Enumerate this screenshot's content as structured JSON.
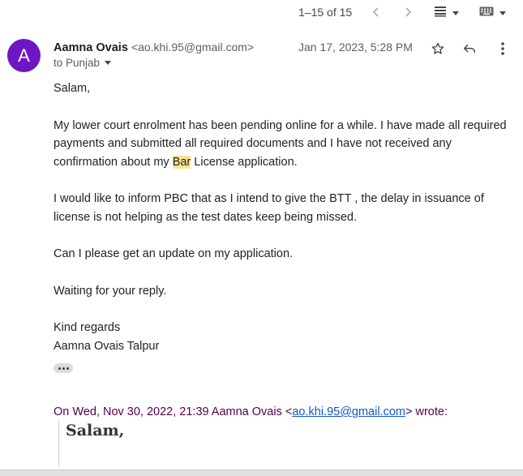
{
  "toolbar": {
    "pagination": "1–15 of 15",
    "prev_icon": "chevron-left-icon",
    "next_icon": "chevron-right-icon",
    "density_icon": "density-icon",
    "keyboard_icon": "keyboard-icon"
  },
  "message": {
    "avatar_letter": "A",
    "avatar_color": "#6f16c4",
    "sender_name": "Aamna Ovais",
    "sender_email": "<ao.khi.95@gmail.com>",
    "recipient": "to Punjab",
    "date": "Jan 17, 2023, 5:28 PM",
    "body": {
      "greeting": "Salam,",
      "p1_before": "My lower court enrolment has been pending online for a while. I have made all required payments and submitted all required documents and I have not received any confirmation about my ",
      "p1_highlight": "Bar",
      "p1_after": " License application.",
      "p2": "I would like to inform PBC that as I intend to give the BTT , the delay in issuance of license is not helping as the test dates keep being missed.",
      "p3": "Can I please get an update on my application.",
      "p4": "Waiting for your reply.",
      "closing": "Kind regards",
      "signature": "Aamna Ovais Talpur"
    },
    "quoted": {
      "prefix": "On Wed, Nov 30, 2022, 21:39 Aamna Ovais <",
      "email_link": "ao.khi.95@gmail.com",
      "suffix": "> wrote:",
      "first_line": "Salam,"
    }
  }
}
